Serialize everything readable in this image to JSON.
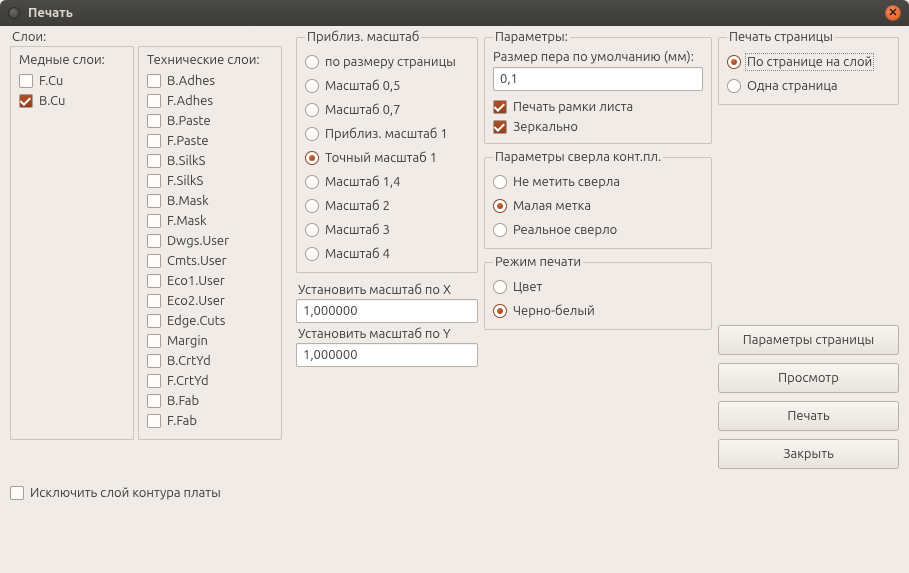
{
  "window": {
    "title": "Печать"
  },
  "layers": {
    "label": "Слои:",
    "copper": {
      "title": "Медные слои:",
      "items": [
        {
          "label": "F.Cu",
          "checked": false
        },
        {
          "label": "B.Cu",
          "checked": true
        }
      ]
    },
    "tech": {
      "title": "Технические слои:",
      "items": [
        {
          "label": "B.Adhes",
          "checked": false
        },
        {
          "label": "F.Adhes",
          "checked": false
        },
        {
          "label": "B.Paste",
          "checked": false
        },
        {
          "label": "F.Paste",
          "checked": false
        },
        {
          "label": "B.SilkS",
          "checked": false
        },
        {
          "label": "F.SilkS",
          "checked": false
        },
        {
          "label": "B.Mask",
          "checked": false
        },
        {
          "label": "F.Mask",
          "checked": false
        },
        {
          "label": "Dwgs.User",
          "checked": false
        },
        {
          "label": "Cmts.User",
          "checked": false
        },
        {
          "label": "Eco1.User",
          "checked": false
        },
        {
          "label": "Eco2.User",
          "checked": false
        },
        {
          "label": "Edge.Cuts",
          "checked": false
        },
        {
          "label": "Margin",
          "checked": false
        },
        {
          "label": "B.CrtYd",
          "checked": false
        },
        {
          "label": "F.CrtYd",
          "checked": false
        },
        {
          "label": "B.Fab",
          "checked": false
        },
        {
          "label": "F.Fab",
          "checked": false
        }
      ]
    },
    "exclude_edge": {
      "label": "Исключить слой контура платы",
      "checked": false
    }
  },
  "scale": {
    "title": "Приблиз. масштаб",
    "options": [
      "по размеру страницы",
      "Масштаб 0,5",
      "Масштаб 0,7",
      "Приблиз. масштаб 1",
      "Точный масштаб 1",
      "Масштаб 1,4",
      "Масштаб 2",
      "Масштаб 3",
      "Масштаб 4"
    ],
    "selected_index": 4,
    "x_label": "Установить масштаб по X",
    "x_value": "1,000000",
    "y_label": "Установить масштаб по Y",
    "y_value": "1,000000"
  },
  "params": {
    "title": "Параметры:",
    "pen_label": "Размер пера по умолчанию (мм):",
    "pen_value": "0,1",
    "frame": {
      "label": "Печать рамки листа",
      "checked": true
    },
    "mirror": {
      "label": "Зеркально",
      "checked": true
    }
  },
  "drill": {
    "title": "Параметры сверла конт.пл.",
    "options": [
      "Не метить сверла",
      "Малая метка",
      "Реальное сверло"
    ],
    "selected_index": 1
  },
  "print_mode": {
    "title": "Режим печати",
    "options": [
      "Цвет",
      "Черно-белый"
    ],
    "selected_index": 1
  },
  "page": {
    "title": "Печать страницы",
    "options": [
      "По странице на слой",
      "Одна страница"
    ],
    "selected_index": 0
  },
  "buttons": {
    "page_setup": "Параметры страницы",
    "preview": "Просмотр",
    "print": "Печать",
    "close": "Закрыть"
  }
}
